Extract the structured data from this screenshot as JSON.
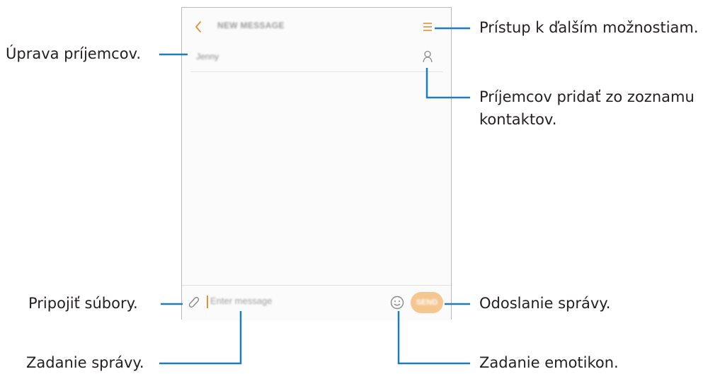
{
  "phone": {
    "header": {
      "title": "NEW MESSAGE"
    },
    "recipient": "Jenny",
    "compose": {
      "placeholder": "Enter message",
      "send_label": "SEND"
    }
  },
  "callouts": {
    "more_options": "Prístup k ďalším možnostiam.",
    "edit_recipients": "Úprava príjemcov.",
    "add_from_contacts_line1": "Príjemcov pridať zo zoznamu",
    "add_from_contacts_line2": "kontaktov.",
    "attach_files": "Pripojiť súbory.",
    "send_message": "Odoslanie správy.",
    "enter_message": "Zadanie správy.",
    "enter_emoticons": "Zadanie emotikon."
  },
  "colors": {
    "accent": "#e0913f",
    "send_button": "#f4c690",
    "leader_line": "#1e7fb8"
  }
}
